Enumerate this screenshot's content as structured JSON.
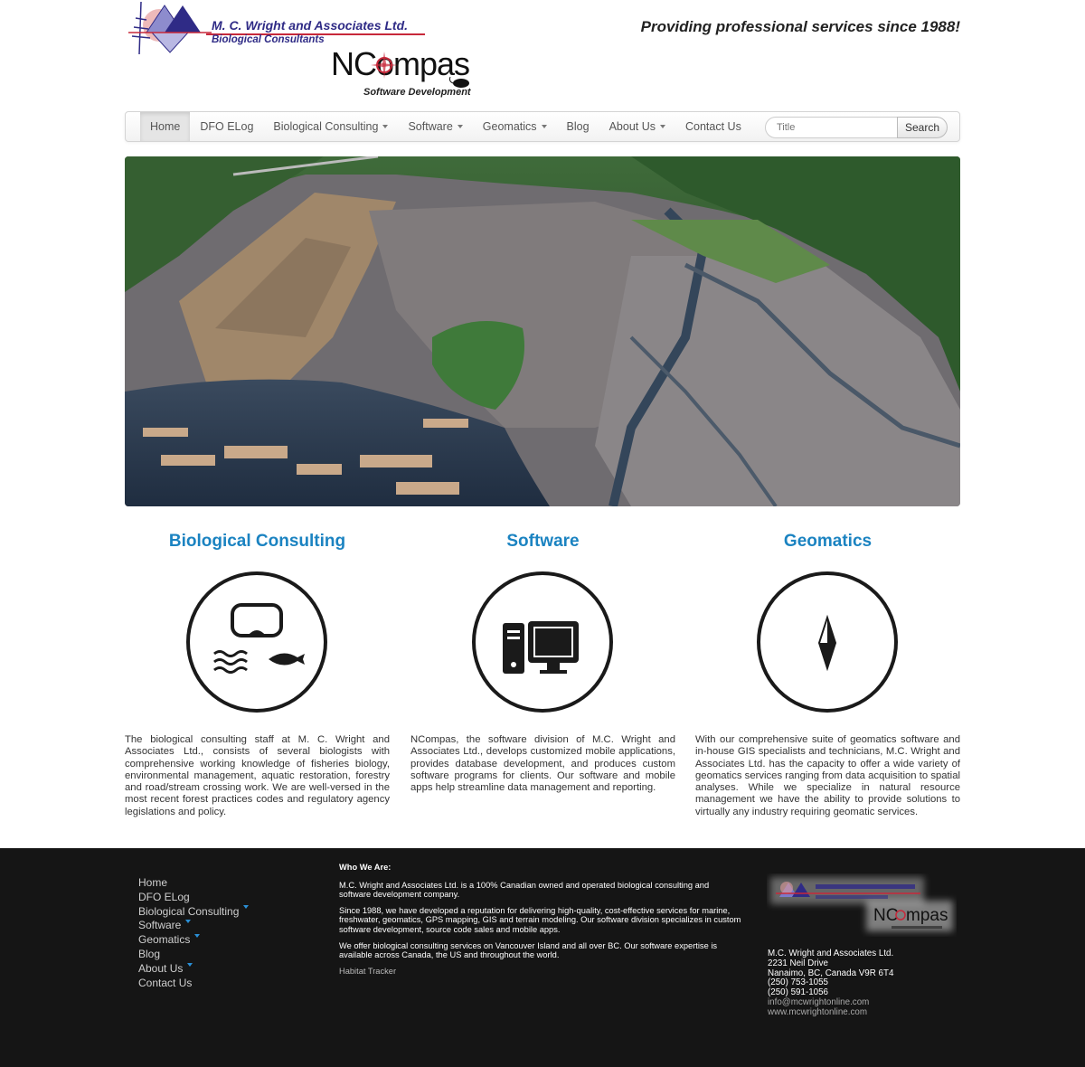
{
  "header": {
    "company_name": "M. C. Wright and Associates Ltd.",
    "company_subtitle": "Biological Consultants",
    "ncompas_name": "NCompas",
    "ncompas_subtitle": "Software Development",
    "tagline": "Providing professional services since 1988!"
  },
  "nav": {
    "items": [
      {
        "label": "Home",
        "active": true,
        "dropdown": false
      },
      {
        "label": "DFO ELog",
        "dropdown": false
      },
      {
        "label": "Biological Consulting",
        "dropdown": true
      },
      {
        "label": "Software",
        "dropdown": true
      },
      {
        "label": "Geomatics",
        "dropdown": true
      },
      {
        "label": "Blog",
        "dropdown": false
      },
      {
        "label": "About Us",
        "dropdown": true
      },
      {
        "label": "Contact Us",
        "dropdown": false
      }
    ],
    "search_placeholder": "Title",
    "search_button": "Search"
  },
  "features": [
    {
      "title": "Biological Consulting",
      "icon": "diving-mask-fish-icon",
      "text": "The biological consulting staff at M. C. Wright and Associates Ltd., consists of several biologists with comprehensive working knowledge of fisheries biology, environmental management, aquatic restoration, forestry and road/stream crossing work. We are well-versed in the most recent forest practices codes and regulatory agency legislations and policy."
    },
    {
      "title": "Software",
      "icon": "computer-icon",
      "text": "NCompas, the software division of M.C. Wright and Associates Ltd., develops customized mobile applications, provides database development, and produces custom software programs for clients. Our software and mobile apps help streamline data management and reporting."
    },
    {
      "title": "Geomatics",
      "icon": "compass-needle-icon",
      "text": "With our comprehensive suite of geomatics software and in-house GIS specialists and technicians, M.C. Wright and Associates Ltd. has the capacity to offer a wide variety of geomatics services ranging from data acquisition to spatial analyses.  While we specialize in natural resource management we have the ability to provide solutions to virtually any industry requiring geomatic services."
    }
  ],
  "footer": {
    "nav": [
      {
        "label": "Home",
        "dropdown": false
      },
      {
        "label": "DFO ELog",
        "dropdown": false
      },
      {
        "label": "Biological Consulting",
        "dropdown": true
      },
      {
        "label": "Software",
        "dropdown": true
      },
      {
        "label": "Geomatics",
        "dropdown": true
      },
      {
        "label": "Blog",
        "dropdown": false
      },
      {
        "label": "About Us",
        "dropdown": true
      },
      {
        "label": "Contact Us",
        "dropdown": false
      }
    ],
    "who_heading": "Who We Are:",
    "who_p1": "M.C. Wright and Associates Ltd. is a 100% Canadian owned and operated biological consulting and software development company.",
    "who_p2": "Since 1988, we have developed a reputation for delivering high-quality, cost-effective services for marine, freshwater, geomatics, GPS mapping, GIS and terrain modeling. Our software division specializes in custom software development, source code sales and mobile apps.",
    "who_p3": "We offer biological consulting services on Vancouver Island and all over BC. Our software expertise is available across Canada, the US and throughout the world.",
    "habitat_link": "Habitat Tracker",
    "address": {
      "company": "M.C. Wright and Associates Ltd.",
      "street": "2231 Neil Drive",
      "city": "Nanaimo, BC, Canada V9R 6T4",
      "phone1": "(250) 753-1055",
      "phone2": "(250) 591-1056",
      "email": "info@mcwrightonline.com",
      "web": "www.mcwrightonline.com"
    }
  },
  "colors": {
    "accent_blue": "#1b83c1",
    "footer_bg": "#151515",
    "logo_navy": "#2f2b86",
    "logo_red": "#c7283a"
  }
}
